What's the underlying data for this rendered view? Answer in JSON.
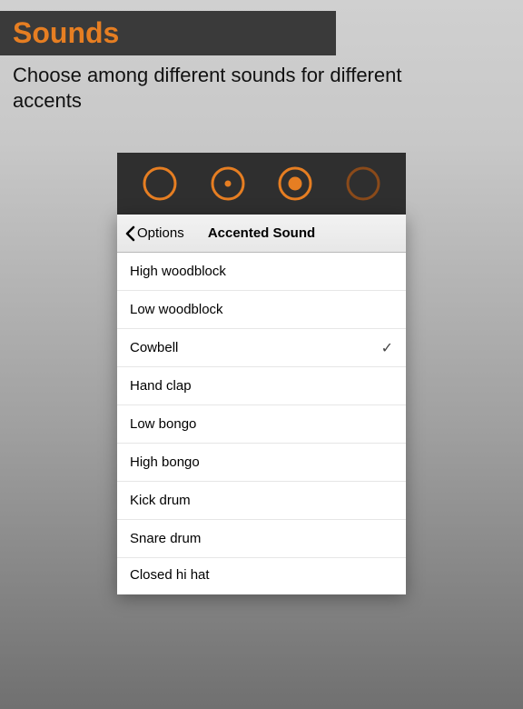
{
  "header": {
    "title": "Sounds",
    "subtitle": "Choose among different sounds for different accents"
  },
  "accent_icons": [
    {
      "name": "accent-ring-empty"
    },
    {
      "name": "accent-ring-small-dot"
    },
    {
      "name": "accent-ring-large-dot"
    },
    {
      "name": "accent-ring-dim"
    }
  ],
  "nav": {
    "back_label": "Options",
    "title": "Accented Sound"
  },
  "sounds": [
    {
      "label": "High woodblock",
      "selected": false
    },
    {
      "label": "Low woodblock",
      "selected": false
    },
    {
      "label": "Cowbell",
      "selected": true
    },
    {
      "label": "Hand clap",
      "selected": false
    },
    {
      "label": "Low bongo",
      "selected": false
    },
    {
      "label": "High bongo",
      "selected": false
    },
    {
      "label": "Kick drum",
      "selected": false
    },
    {
      "label": "Snare drum",
      "selected": false
    },
    {
      "label": "Closed hi hat",
      "selected": false
    }
  ],
  "colors": {
    "accent": "#e67e22",
    "accent_dim": "#8a4a1a"
  },
  "check_glyph": "✓"
}
